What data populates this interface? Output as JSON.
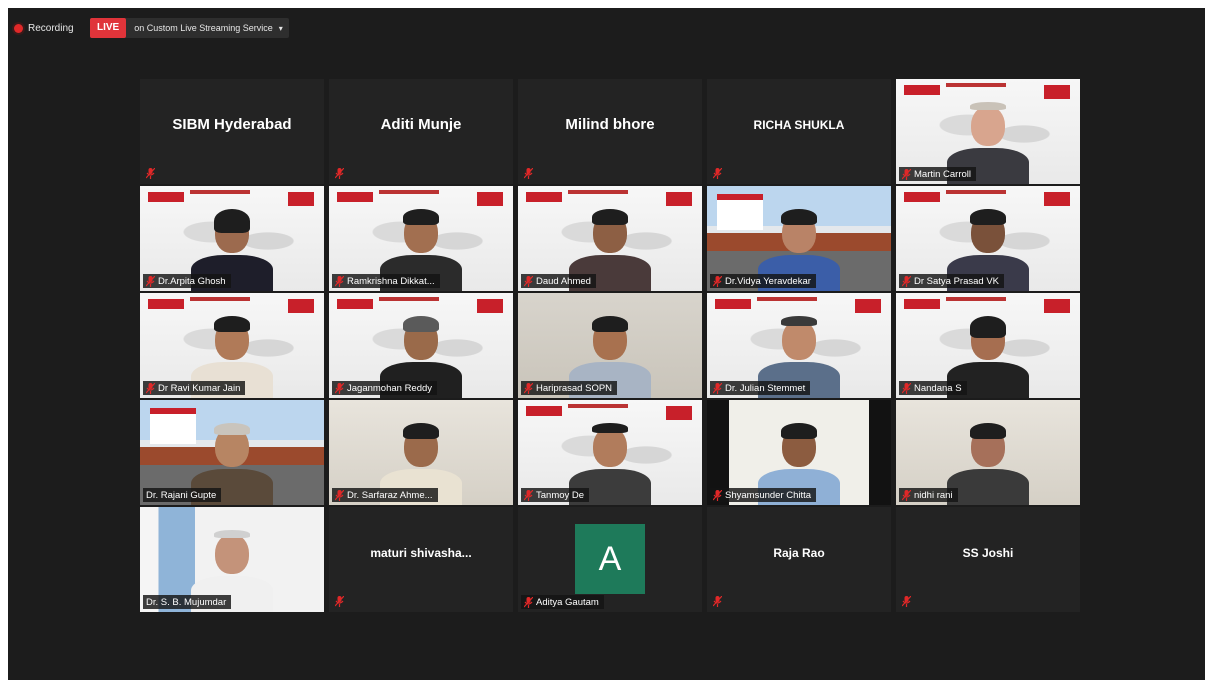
{
  "recording": {
    "label": "Recording",
    "live_badge": "LIVE",
    "stream_label": "on Custom Live Streaming Service",
    "caret": "▾"
  },
  "colors": {
    "live_red": "#e0343a",
    "active_speaker_outline": "#d7f06a",
    "muted_mic": "#e02828",
    "avatar_green": "#1e7a5a"
  },
  "participants": [
    {
      "name": "SIBM Hyderabad",
      "video": false
    },
    {
      "name": "Aditi Munje",
      "video": false
    },
    {
      "name": "Milind bhore",
      "video": false
    },
    {
      "name": "RICHA SHUKLA",
      "video": false
    },
    {
      "name": "Martin Carroll",
      "video": true
    },
    {
      "name": "Dr.Arpita Ghosh",
      "video": true
    },
    {
      "name": "Ramkrishna Dikkat...",
      "video": true
    },
    {
      "name": "Daud Ahmed",
      "video": true
    },
    {
      "name": "Dr.Vidya Yeravdekar",
      "video": true
    },
    {
      "name": "Dr Satya Prasad VK",
      "video": true
    },
    {
      "name": "Dr Ravi Kumar Jain",
      "video": true
    },
    {
      "name": "Jaganmohan Reddy",
      "video": true
    },
    {
      "name": "Hariprasad SOPN",
      "video": true
    },
    {
      "name": "Dr. Julian Stemmet",
      "video": true
    },
    {
      "name": "Nandana S",
      "video": true
    },
    {
      "name": "Dr. Rajani Gupte",
      "video": true
    },
    {
      "name": "Dr. Sarfaraz Ahme...",
      "video": true
    },
    {
      "name": "Tanmoy De",
      "video": true
    },
    {
      "name": "Shyamsunder Chitta",
      "video": true
    },
    {
      "name": "nidhi rani",
      "video": true
    },
    {
      "name": "Dr. S. B. Mujumdar",
      "video": true,
      "active": true
    },
    {
      "name": "maturi shivasha...",
      "video": false
    },
    {
      "name": "Aditya Gautam",
      "video": false,
      "avatar_letter": "A"
    },
    {
      "name": "Raja Rao",
      "video": false
    },
    {
      "name": "SS Joshi",
      "video": false
    }
  ]
}
